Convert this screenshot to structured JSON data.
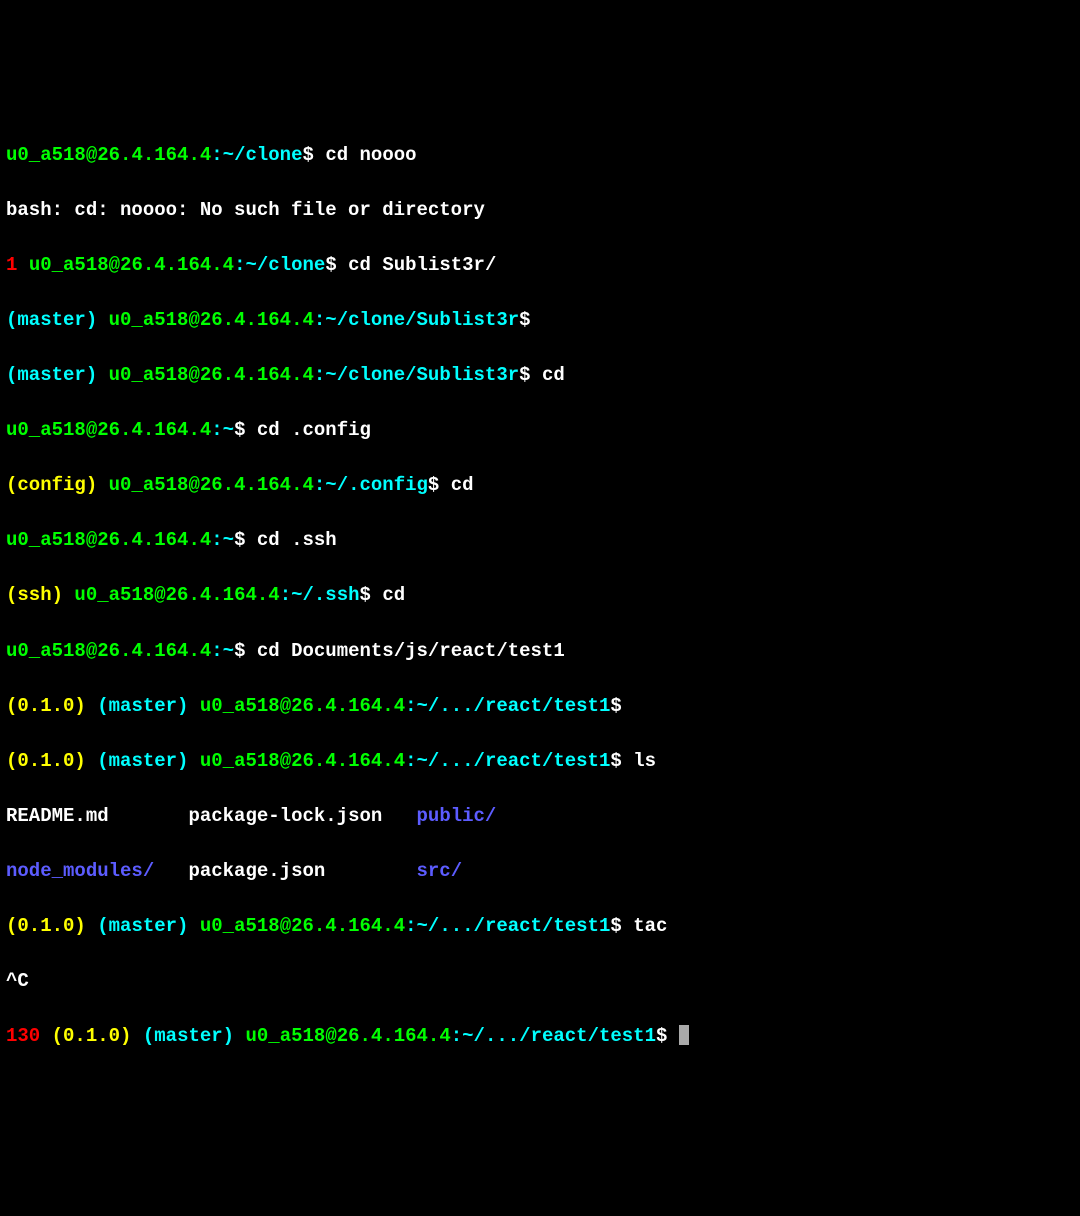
{
  "user": "u0_a518",
  "host": "26.4.164.4",
  "dollar": "$",
  "tilde": "~",
  "sep1": "@",
  "sep2": ":",
  "paths": {
    "clone": "~/clone",
    "sublist3r": "~/clone/Sublist3r",
    "home": "~",
    "config": "~/.config",
    "ssh": "~/.ssh",
    "react_test1": "~/.../react/test1"
  },
  "branches": {
    "master": "(master)",
    "config": "(config)",
    "ssh": "(ssh)"
  },
  "version": "(0.1.0)",
  "exit_codes": {
    "one": "1",
    "one_thirty": "130"
  },
  "cmds": {
    "cd_noooo": "cd noooo",
    "cd_sublist3r": "cd Sublist3r/",
    "cd": "cd",
    "cd_config": "cd .config",
    "cd_ssh": "cd .ssh",
    "cd_react": "cd Documents/js/react/test1",
    "ls": "ls",
    "tac": "tac"
  },
  "output": {
    "err_noooo": "bash: cd: noooo: No such file or directory",
    "ctrl_c": "^C",
    "ls_readme": "README.md",
    "ls_pkglock": "package-lock.json",
    "ls_public": "public/",
    "ls_nodemod": "node_modules/",
    "ls_pkgjson": "package.json",
    "ls_src": "src/"
  },
  "sp": " ",
  "gap8": "        ",
  "gap3": "   ",
  "gap2": "  ",
  "gap7": "       "
}
